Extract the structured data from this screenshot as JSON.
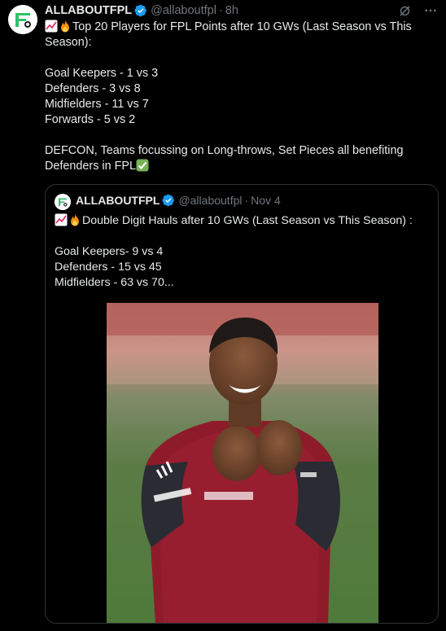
{
  "tweet": {
    "author_name": "ALLABOUTFPL",
    "handle": "@allaboutfpl",
    "separator": "·",
    "time": "8h",
    "line_1": "Top 20 Players for FPL Points after 10 GWs (Last Season vs This Season):",
    "body": "Goal Keepers - 1 vs 3\nDefenders - 3 vs 8\nMidfielders - 11 vs 7\nForwards - 5 vs 2\n\nDEFCON, Teams focussing on Long-throws, Set Pieces all benefiting Defenders in FPL",
    "emoji_lead": [
      "chart-increasing-emoji",
      "fire-emoji"
    ],
    "emoji_trail": "check-mark-button-emoji"
  },
  "quoted_tweet": {
    "author_name": "ALLABOUTFPL",
    "handle": "@allaboutfpl",
    "separator": "·",
    "date": "Nov 4",
    "line_1": "Double Digit Hauls after 10 GWs (Last Season vs This Season) :",
    "body": "Goal Keepers- 9 vs 4\nDefenders - 15 vs 45\nMidfielders - 63 vs 70...",
    "emoji_lead": [
      "chart-increasing-emoji",
      "fire-emoji"
    ],
    "media_description_icon": "photo-player-celebrating"
  },
  "icons": {
    "verified": "verified-badge-icon",
    "grok": "grok-icon",
    "more": "more-options-icon"
  },
  "colors": {
    "background": "#000000",
    "text": "#e7e9ea",
    "muted": "#71767b",
    "verified": "#1d9bf0",
    "border": "#2f3336",
    "logo_green": "#2ec26b"
  }
}
